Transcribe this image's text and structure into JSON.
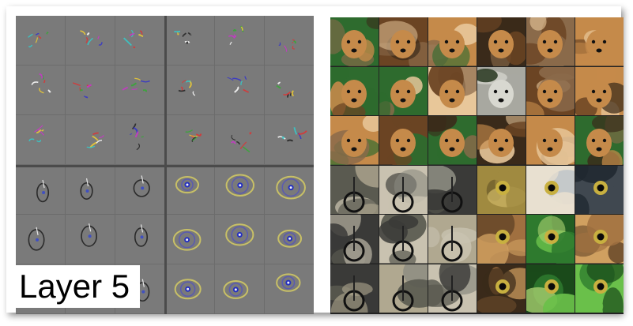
{
  "figure": {
    "label": "Layer 5"
  },
  "left_panel": {
    "description_icon": "deconvolution-feature-grid",
    "groups": [
      {
        "name": "top-left"
      },
      {
        "name": "top-right"
      },
      {
        "name": "bottom-left"
      },
      {
        "name": "bottom-right"
      }
    ]
  },
  "right_panel": {
    "rows": [
      {
        "tiles": [
          "dog",
          "dog",
          "dog",
          "dog",
          "dog",
          "dog"
        ]
      },
      {
        "tiles": [
          "dog",
          "dog",
          "dog",
          "wolf",
          "dog",
          "dog"
        ]
      },
      {
        "tiles": [
          "dog",
          "dog",
          "dog",
          "dog",
          "dog",
          "dog"
        ]
      },
      {
        "tiles": [
          "unicycle",
          "unicycle",
          "unicycle",
          "reptile-eye",
          "bird-eye",
          "bird-eye"
        ]
      },
      {
        "tiles": [
          "unicycle",
          "unicycle",
          "unicycle",
          "bird",
          "lizard",
          "bird"
        ]
      },
      {
        "tiles": [
          "unicycle",
          "unicycle",
          "unicycle",
          "bird",
          "lizard",
          "lizard"
        ]
      }
    ]
  }
}
